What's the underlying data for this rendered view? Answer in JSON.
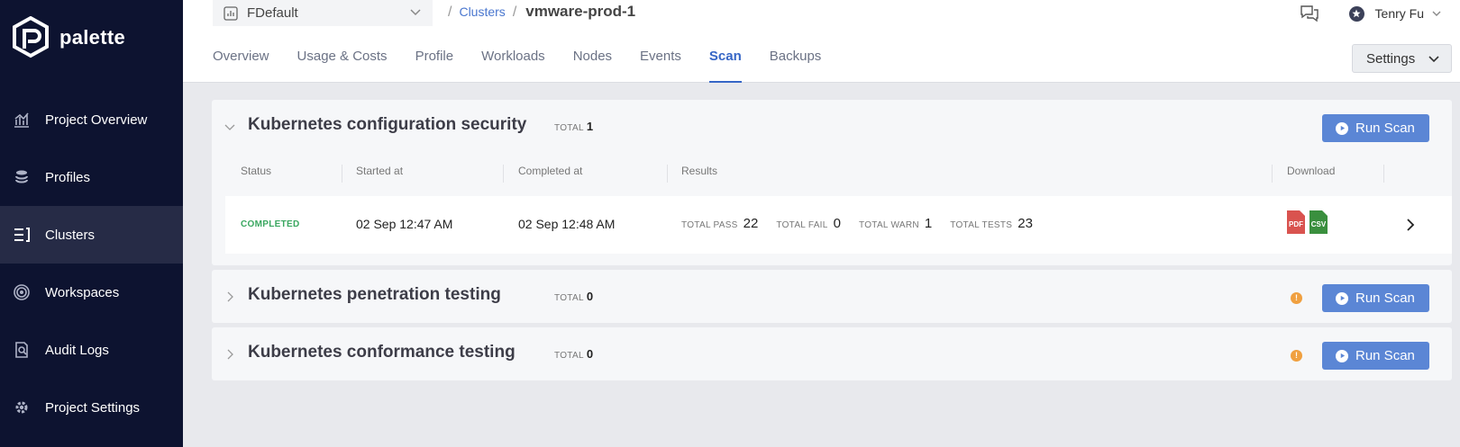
{
  "brand": {
    "name": "palette"
  },
  "sidebar": {
    "items": [
      {
        "label": "Project Overview",
        "icon": "chart-icon",
        "active": false
      },
      {
        "label": "Profiles",
        "icon": "stack-icon",
        "active": false
      },
      {
        "label": "Clusters",
        "icon": "clusters-icon",
        "active": true
      },
      {
        "label": "Workspaces",
        "icon": "workspace-icon",
        "active": false
      },
      {
        "label": "Audit Logs",
        "icon": "audit-icon",
        "active": false
      },
      {
        "label": "Project Settings",
        "icon": "gear-icon",
        "active": false
      }
    ]
  },
  "header": {
    "project": "FDefault",
    "breadcrumb": {
      "link": "Clusters",
      "current": "vmware-prod-1"
    },
    "user": "Tenry Fu",
    "settings_label": "Settings",
    "tabs": [
      {
        "label": "Overview",
        "active": false
      },
      {
        "label": "Usage & Costs",
        "active": false
      },
      {
        "label": "Profile",
        "active": false
      },
      {
        "label": "Workloads",
        "active": false
      },
      {
        "label": "Nodes",
        "active": false
      },
      {
        "label": "Events",
        "active": false
      },
      {
        "label": "Scan",
        "active": true
      },
      {
        "label": "Backups",
        "active": false
      }
    ]
  },
  "scans": [
    {
      "title": "Kubernetes configuration security",
      "total_label": "TOTAL",
      "total": "1",
      "run_label": "Run Scan",
      "expanded": true,
      "columns": [
        "Status",
        "Started at",
        "Completed at",
        "Results",
        "Download"
      ],
      "row": {
        "status": "COMPLETED",
        "started": "02 Sep 12:47 AM",
        "completed": "02 Sep 12:48 AM",
        "results": [
          {
            "label": "TOTAL PASS",
            "value": "22"
          },
          {
            "label": "TOTAL FAIL",
            "value": "0"
          },
          {
            "label": "TOTAL WARN",
            "value": "1"
          },
          {
            "label": "TOTAL TESTS",
            "value": "23"
          }
        ],
        "downloads": [
          {
            "label": "PDF",
            "color": "#d9534f"
          },
          {
            "label": "CSV",
            "color": "#3a8f3e"
          }
        ]
      }
    },
    {
      "title": "Kubernetes penetration testing",
      "total_label": "TOTAL",
      "total": "0",
      "run_label": "Run Scan",
      "expanded": false,
      "warn": "!"
    },
    {
      "title": "Kubernetes conformance testing",
      "total_label": "TOTAL",
      "total": "0",
      "run_label": "Run Scan",
      "expanded": false,
      "warn": "!"
    }
  ]
}
